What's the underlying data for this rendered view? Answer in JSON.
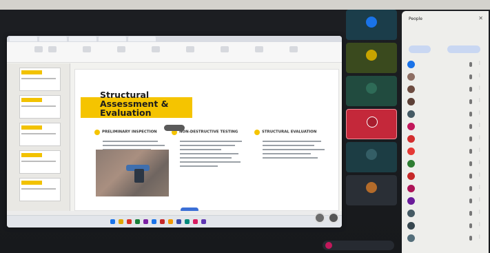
{
  "slide": {
    "title": "Structural Assessment & Evaluation",
    "sections": [
      {
        "heading": "PRELIMINARY INSPECTION"
      },
      {
        "heading": "NON-DESTRUCTIVE TESTING"
      },
      {
        "heading": "STRUCTURAL EVALUATION"
      }
    ]
  },
  "people": {
    "title": "People"
  },
  "colors": {
    "accent": "#f5c400",
    "tile_red": "#c4283a",
    "tile_green": "#214b3f",
    "panel_bg": "#eeeeeb"
  }
}
